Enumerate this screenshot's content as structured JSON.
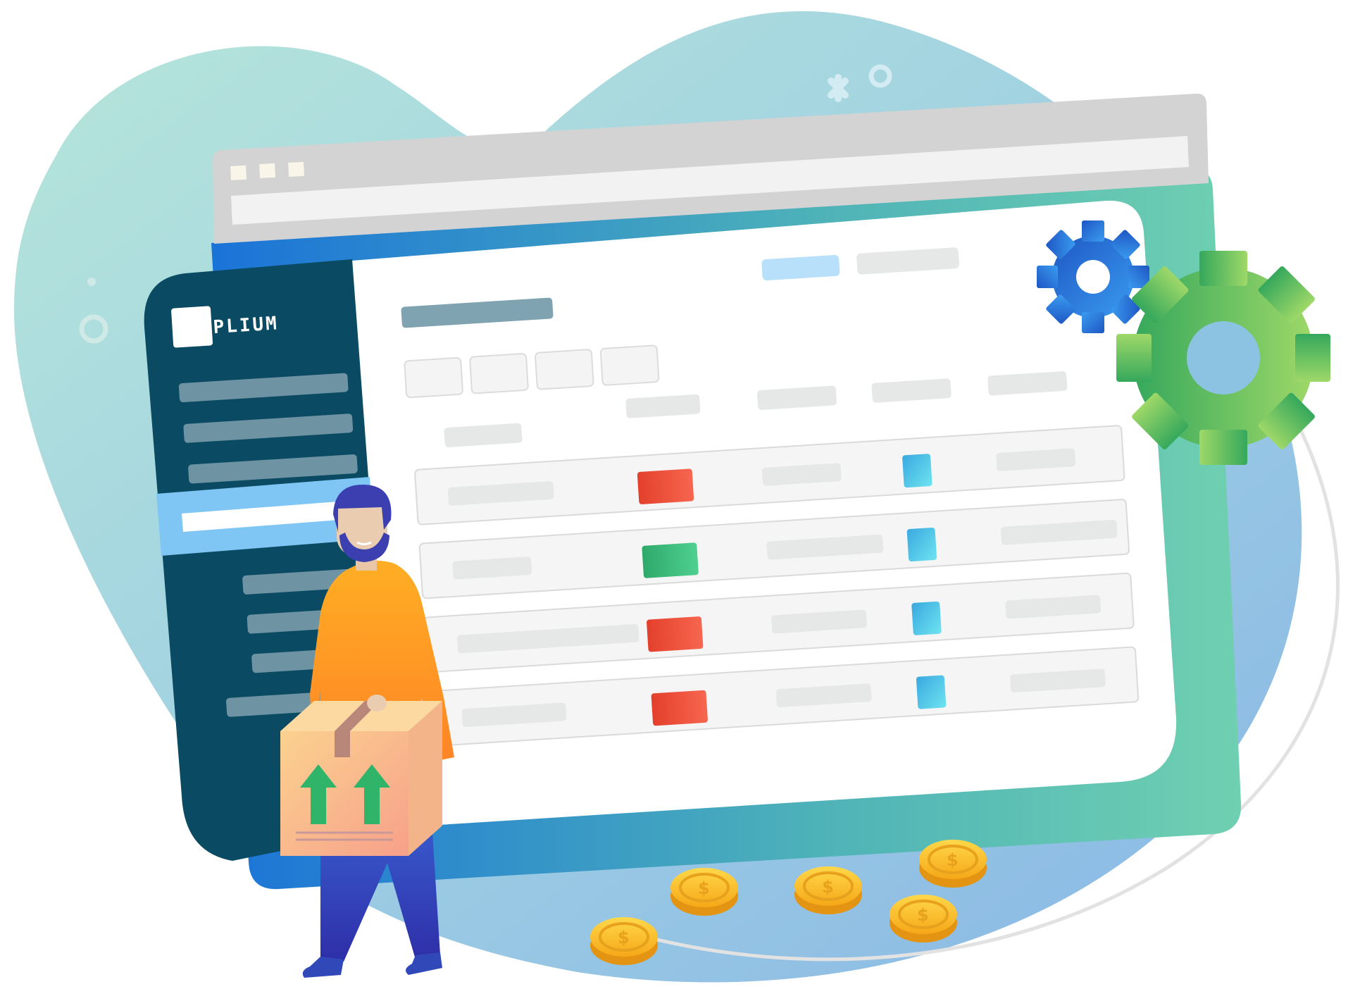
{
  "app": {
    "brand_name": "SUPPLIUM"
  },
  "colors": {
    "sidebar": "#0a4a63",
    "sidebar_item": "#6e93a3",
    "sidebar_active": "#7fc6f5",
    "status_red": "#e8452e",
    "status_green": "#2fae6a",
    "status_blue": "#3db8e6",
    "gear_blue": "#2a72d6",
    "gear_green": "#5cbd5a",
    "coin_gold": "#f7b82a",
    "person_shirt": "#ff9226",
    "person_pants": "#3149b8"
  },
  "icons": {
    "window_controls": "window-control-squares",
    "gears": [
      "gear-blue-icon",
      "gear-green-icon"
    ],
    "coins": "dollar-coin-icon",
    "box": "shipping-box-this-side-up-icon"
  },
  "table": {
    "rows": [
      {
        "status": "red",
        "tag": "blue"
      },
      {
        "status": "green",
        "tag": "blue"
      },
      {
        "status": "red",
        "tag": "blue"
      },
      {
        "status": "red",
        "tag": "blue"
      }
    ]
  }
}
